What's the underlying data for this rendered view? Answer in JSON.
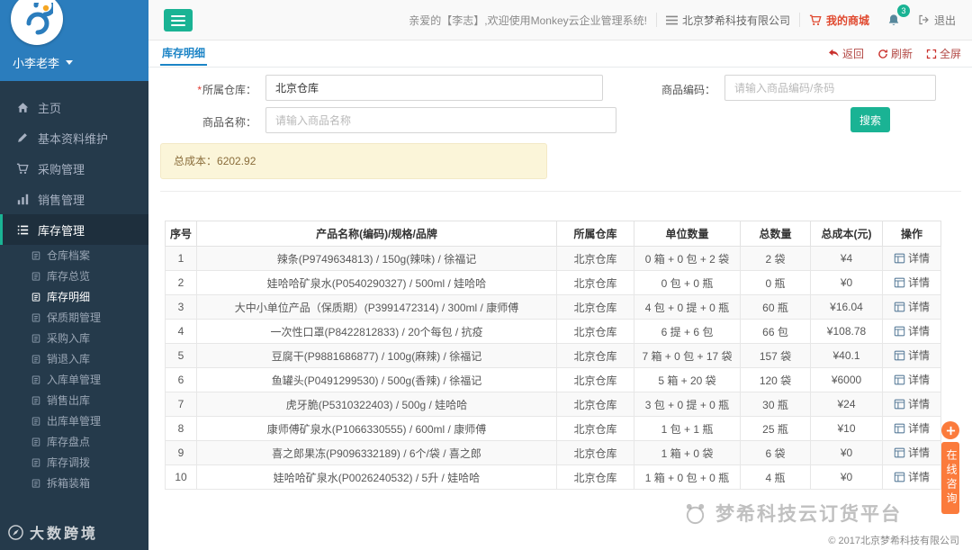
{
  "sidebar": {
    "username": "小李老李",
    "items": [
      {
        "id": "home",
        "label": "主页",
        "icon": "home-icon"
      },
      {
        "id": "edit",
        "label": "基本资料维护",
        "icon": "edit-icon"
      },
      {
        "id": "purchase",
        "label": "采购管理",
        "icon": "cart-icon"
      },
      {
        "id": "sales",
        "label": "销售管理",
        "icon": "chart-icon"
      },
      {
        "id": "inventory",
        "label": "库存管理",
        "icon": "inventory-icon",
        "active": true
      }
    ],
    "subitems": [
      {
        "label": "仓库档案"
      },
      {
        "label": "库存总览"
      },
      {
        "label": "库存明细",
        "active": true
      },
      {
        "label": "保质期管理"
      },
      {
        "label": "采购入库"
      },
      {
        "label": "销退入库"
      },
      {
        "label": "入库单管理"
      },
      {
        "label": "销售出库"
      },
      {
        "label": "出库单管理"
      },
      {
        "label": "库存盘点"
      },
      {
        "label": "库存调拨"
      },
      {
        "label": "拆箱装箱"
      }
    ]
  },
  "header": {
    "welcome": "亲爱的【李志】,欢迎使用Monkey云企业管理系统!",
    "company": "北京梦希科技有限公司",
    "mall": "我的商城",
    "notification_count": "3",
    "logout": "退出"
  },
  "breadcrumb": {
    "title": "库存明细",
    "actions": [
      {
        "id": "back",
        "label": "返回",
        "icon": "back-icon"
      },
      {
        "id": "refresh",
        "label": "刷新",
        "icon": "refresh-icon"
      },
      {
        "id": "fullscreen",
        "label": "全屏",
        "icon": "fullscreen-icon"
      }
    ]
  },
  "filters": {
    "required_mark": "*",
    "warehouse_label": "所属仓库：",
    "warehouse_value": "北京仓库",
    "code_label": "商品编码：",
    "code_placeholder": "请输入商品编码/条码",
    "name_label": "商品名称：",
    "name_placeholder": "请输入商品名称",
    "search_label": "搜索",
    "total_label": "总成本：",
    "total_value": "6202.92"
  },
  "table": {
    "headers": [
      "序号",
      "产品名称(编码)/规格/品牌",
      "所属仓库",
      "单位数量",
      "总数量",
      "总成本(元)",
      "操作"
    ],
    "detail_label": "详情",
    "rows": [
      [
        "1",
        "辣条(P9749634813) / 150g(辣味) / 徐福记",
        "北京仓库",
        "0 箱 + 0 包 + 2 袋",
        "2 袋",
        "¥4"
      ],
      [
        "2",
        "娃哈哈矿泉水(P0540290327) / 500ml / 娃哈哈",
        "北京仓库",
        "0 包 + 0 瓶",
        "0 瓶",
        "¥0"
      ],
      [
        "3",
        "大中小单位产品（保质期）(P3991472314) / 300ml / 康师傅",
        "北京仓库",
        "4 包 + 0 提 + 0 瓶",
        "60 瓶",
        "¥16.04"
      ],
      [
        "4",
        "一次性口罩(P8422812833) / 20个每包 / 抗疫",
        "北京仓库",
        "6 提 + 6 包",
        "66 包",
        "¥108.78"
      ],
      [
        "5",
        "豆腐干(P9881686877) / 100g(麻辣) / 徐福记",
        "北京仓库",
        "7 箱 + 0 包 + 17 袋",
        "157 袋",
        "¥40.1"
      ],
      [
        "6",
        "鱼罐头(P0491299530) / 500g(香辣) / 徐福记",
        "北京仓库",
        "5 箱 + 20 袋",
        "120 袋",
        "¥6000"
      ],
      [
        "7",
        "虎牙脆(P5310322403) / 500g / 娃哈哈",
        "北京仓库",
        "3 包 + 0 提 + 0 瓶",
        "30 瓶",
        "¥24"
      ],
      [
        "8",
        "康师傅矿泉水(P1066330555) / 600ml / 康师傅",
        "北京仓库",
        "1 包 + 1 瓶",
        "25 瓶",
        "¥10"
      ],
      [
        "9",
        "喜之郎果冻(P9096332189) / 6个/袋 / 喜之郎",
        "北京仓库",
        "1 箱 + 0 袋",
        "6 袋",
        "¥0"
      ],
      [
        "10",
        "娃哈哈矿泉水(P0026240532) / 5升 / 娃哈哈",
        "北京仓库",
        "1 箱 + 0 包 + 0 瓶",
        "4 瓶",
        "¥0"
      ]
    ]
  },
  "footer": {
    "copyright": "© 2017北京梦希科技有限公司"
  },
  "widgets": {
    "online_consult": "在线咨询"
  },
  "watermarks": {
    "sidebar": "大数跨境",
    "brand": "梦希科技云订货平台"
  },
  "colors": {
    "accent_green": "#1ab394",
    "sidebar_bg": "#253a4b",
    "logo_blue": "#2b7dbd",
    "title_blue": "#1c84c6",
    "action_red": "#c9302c",
    "mall_red": "#e0492f",
    "alert_bg": "#fbf5d9",
    "consult_orange": "#fb7b3c"
  }
}
